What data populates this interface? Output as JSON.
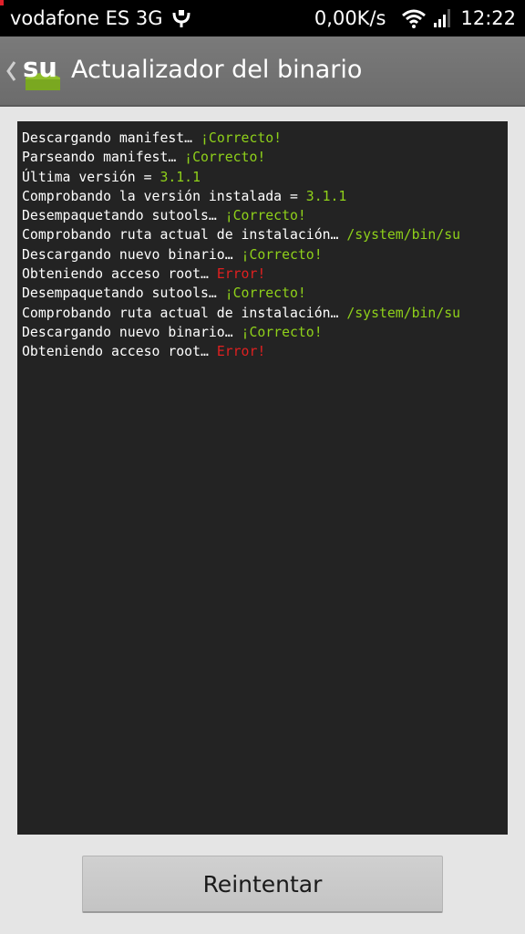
{
  "status_bar": {
    "carrier": "vodafone ES 3G",
    "speed": "0,00K/s",
    "time": "12:22"
  },
  "action_bar": {
    "logo_text": "su",
    "title": "Actualizador del binario"
  },
  "log": [
    {
      "prefix": "Descargando manifest… ",
      "result": "¡Correcto!",
      "status": "ok"
    },
    {
      "prefix": "Parseando manifest… ",
      "result": "¡Correcto!",
      "status": "ok"
    },
    {
      "prefix": "Última versión = ",
      "result": "3.1.1",
      "status": "value"
    },
    {
      "prefix": "Comprobando la versión instalada = ",
      "result": "3.1.1",
      "status": "value"
    },
    {
      "prefix": "Desempaquetando sutools… ",
      "result": "¡Correcto!",
      "status": "ok"
    },
    {
      "prefix": "Comprobando ruta actual de instalación… ",
      "result": "/system/bin/su",
      "status": "value"
    },
    {
      "prefix": "Descargando nuevo binario… ",
      "result": "¡Correcto!",
      "status": "ok"
    },
    {
      "prefix": "Obteniendo acceso root… ",
      "result": "Error!",
      "status": "error"
    },
    {
      "prefix": "Desempaquetando sutools… ",
      "result": "¡Correcto!",
      "status": "ok"
    },
    {
      "prefix": "Comprobando ruta actual de instalación… ",
      "result": "/system/bin/su",
      "status": "value"
    },
    {
      "prefix": "Descargando nuevo binario… ",
      "result": "¡Correcto!",
      "status": "ok"
    },
    {
      "prefix": "Obteniendo acceso root… ",
      "result": "Error!",
      "status": "error"
    }
  ],
  "retry_button": {
    "label": "Reintentar"
  },
  "colors": {
    "ok": "#8fd11a",
    "error": "#e02020",
    "log_bg": "#232323",
    "action_bar": "#737373"
  }
}
